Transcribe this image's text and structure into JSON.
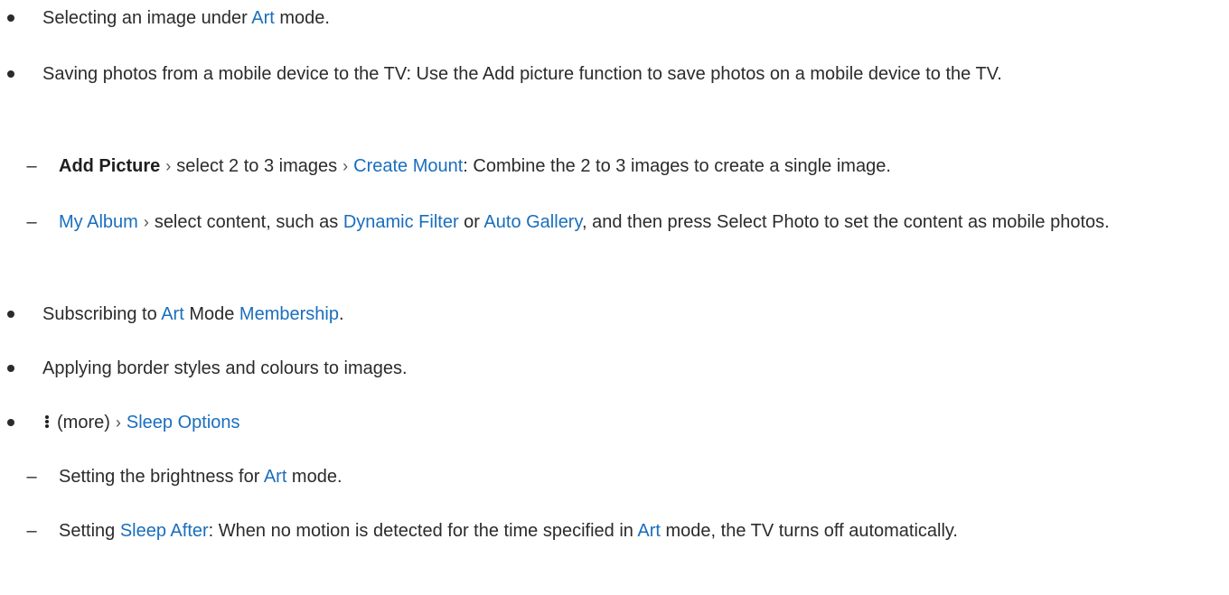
{
  "bullets": [
    {
      "parts": [
        {
          "text": "Selecting an image under "
        },
        {
          "text": "Art",
          "link": true
        },
        {
          "text": " mode."
        }
      ]
    },
    {
      "parts": [
        {
          "text": "Saving photos from a mobile device to the TV: Use the Add picture function to save photos on a mobile device to the TV."
        }
      ]
    },
    {
      "sub": true,
      "parts": [
        {
          "text": "Add Picture",
          "bold": true
        },
        {
          "chevron": true
        },
        {
          "text": "select 2 to 3 images"
        },
        {
          "chevron": true
        },
        {
          "text": "Create Mount",
          "link": true
        },
        {
          "text": ": Combine the 2 to 3 images to create a single image."
        }
      ]
    },
    {
      "sub": true,
      "parts": [
        {
          "text": "My Album",
          "link": true
        },
        {
          "chevron": true
        },
        {
          "text": "select content, such as "
        },
        {
          "text": "Dynamic Filter",
          "link": true
        },
        {
          "text": " or "
        },
        {
          "text": "Auto Gallery",
          "link": true
        },
        {
          "text": ", and then press Select Photo to set the content as mobile photos."
        }
      ]
    },
    {
      "parts": [
        {
          "text": "Subscribing to "
        },
        {
          "text": "Art",
          "link": true
        },
        {
          "text": " Mode "
        },
        {
          "text": "Membership",
          "link": true
        },
        {
          "text": "."
        }
      ]
    },
    {
      "parts": [
        {
          "text": "Applying border styles and colours to images."
        }
      ]
    },
    {
      "parts": [
        {
          "icon": "more-icon"
        },
        {
          "text": "(more)"
        },
        {
          "chevron": true
        },
        {
          "text": "Sleep Options",
          "link": true
        }
      ]
    },
    {
      "sub": true,
      "parts": [
        {
          "text": "Setting the brightness for "
        },
        {
          "text": "Art",
          "link": true
        },
        {
          "text": " mode."
        }
      ]
    },
    {
      "sub": true,
      "parts": [
        {
          "text": "Setting "
        },
        {
          "text": "Sleep After",
          "link": true
        },
        {
          "text": ": When no motion is detected for the time specified in "
        },
        {
          "text": "Art",
          "link": true
        },
        {
          "text": " mode, the TV turns off automatically."
        }
      ]
    }
  ],
  "colors": {
    "text": "#2b2b2b",
    "link": "#1a6ebd"
  }
}
